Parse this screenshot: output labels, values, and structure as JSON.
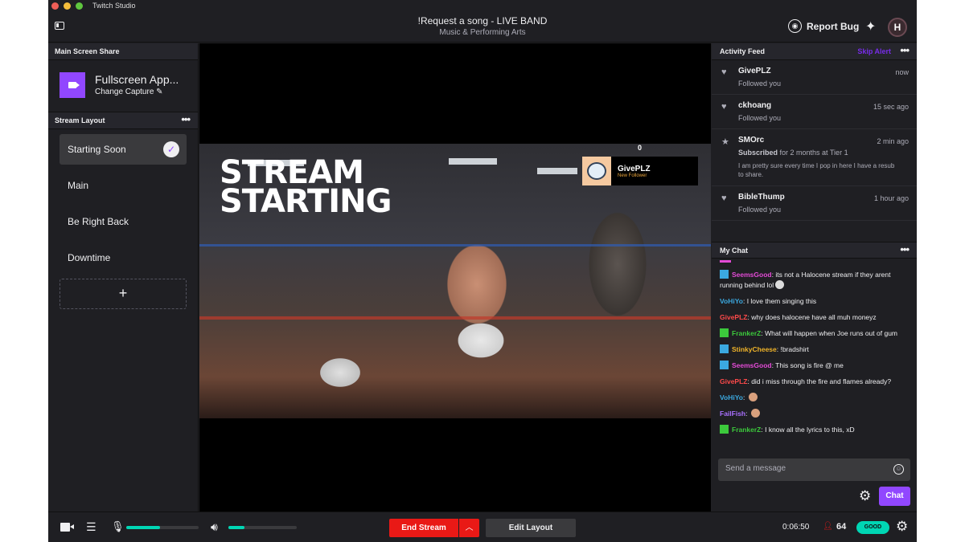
{
  "window": {
    "app_title": "Twitch Studio"
  },
  "header": {
    "stream_title": "!Request a song - LIVE BAND",
    "category": "Music & Performing Arts",
    "report_bug_label": "Report Bug",
    "avatar_initial": "H"
  },
  "left_panel": {
    "screen_share": {
      "section_title": "Main Screen Share",
      "capture_name": "Fullscreen App...",
      "change_capture_label": "Change Capture"
    },
    "stream_layout": {
      "section_title": "Stream Layout",
      "items": [
        {
          "label": "Starting Soon",
          "active": true
        },
        {
          "label": "Main",
          "active": false
        },
        {
          "label": "Be Right Back",
          "active": false
        },
        {
          "label": "Downtime",
          "active": false
        }
      ],
      "add_label": "+"
    }
  },
  "preview": {
    "overlay_title_line1": "STREAM",
    "overlay_title_line2": "STARTING",
    "alert": {
      "user": "GivePLZ",
      "type": "New Follower"
    },
    "counter": "0"
  },
  "activity_feed": {
    "title": "Activity Feed",
    "skip_alert_label": "Skip Alert",
    "items": [
      {
        "icon": "heart-icon",
        "user": "GivePLZ",
        "time": "now",
        "action": "Followed you"
      },
      {
        "icon": "heart-icon",
        "user": "ckhoang",
        "time": "15 sec ago",
        "action": "Followed you"
      },
      {
        "icon": "star-icon",
        "user": "SMOrc",
        "time": "2 min ago",
        "action_bold": "Subscribed",
        "action": "for 2 months at Tier 1",
        "message": "I am pretty sure every time I pop in here I have a resub to share."
      },
      {
        "icon": "heart-icon",
        "user": "BibleThump",
        "time": "1 hour ago",
        "action": "Followed you"
      }
    ]
  },
  "chat": {
    "title": "My Chat",
    "messages": [
      {
        "badge": "crown",
        "user": "SeemsGood",
        "color": "#e34bd6",
        "text": "its not a Halocene stream if they arent running behind lol",
        "emote": "white"
      },
      {
        "badge": null,
        "user": "VoHiYo",
        "color": "#3ba9e0",
        "text": " I love them singing this",
        "emote": null
      },
      {
        "badge": null,
        "user": "GivePLZ",
        "color": "#ff4a4a",
        "text": "why does halocene have all muh moneyz",
        "emote": null
      },
      {
        "badge": "sword",
        "user": "FrankerZ",
        "color": "#3cc93c",
        "text": "What will happen when Joe runs out of gum",
        "emote": null
      },
      {
        "badge": "crown",
        "user": "StinkyCheese",
        "color": "#f0b429",
        "text": "!bradshirt",
        "emote": null
      },
      {
        "badge": "crown",
        "user": "SeemsGood",
        "color": "#e34bd6",
        "text": "This song is fire @ me",
        "emote": null
      },
      {
        "badge": null,
        "user": "GivePLZ",
        "color": "#ff4a4a",
        "text": "did i miss through the fire and flames already?",
        "emote": null
      },
      {
        "badge": null,
        "user": "VoHiYo",
        "color": "#3ba9e0",
        "text": "",
        "emote": "face"
      },
      {
        "badge": null,
        "user": "FailFish",
        "color": "#a970ff",
        "text": "",
        "emote": "face"
      },
      {
        "badge": "sword",
        "user": "FrankerZ",
        "color": "#3cc93c",
        "text": "I know all the lyrics to this, xD",
        "emote": null
      }
    ],
    "input_placeholder": "Send a message",
    "send_label": "Chat"
  },
  "bottom_bar": {
    "mic_level": 0.47,
    "speaker_level": 0.24,
    "end_stream_label": "End Stream",
    "edit_layout_label": "Edit Layout",
    "uptime": "0:06:50",
    "viewer_count": "64",
    "health_label": "GOOD"
  },
  "colors": {
    "accent": "#9147ff",
    "end_stream": "#e91916",
    "health": "#00d6b4"
  }
}
